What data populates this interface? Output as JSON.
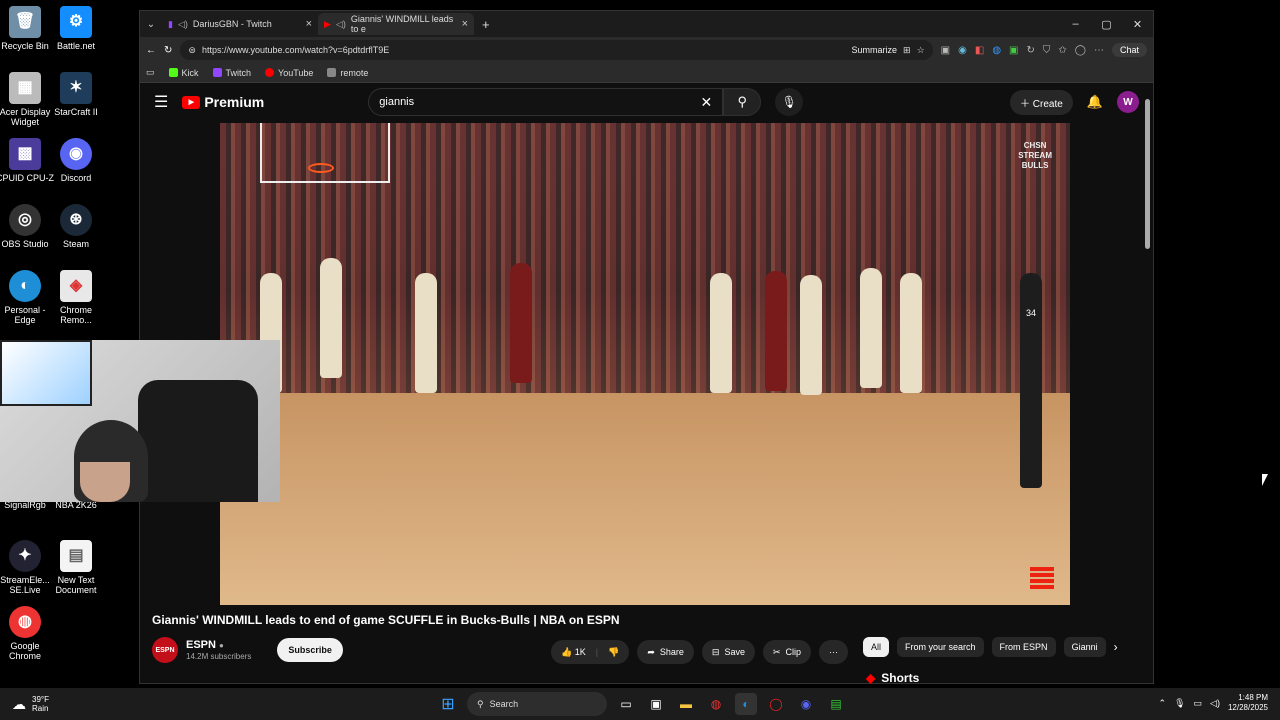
{
  "desktop": {
    "icons": [
      {
        "label": "Recycle Bin",
        "glyph": "🗑"
      },
      {
        "label": "Battle.net",
        "glyph": "⚙"
      },
      {
        "label": "Acer Display Widget",
        "glyph": "▦"
      },
      {
        "label": "StarCraft II",
        "glyph": "✶"
      },
      {
        "label": "CPUID CPU-Z",
        "glyph": "▩"
      },
      {
        "label": "Discord",
        "glyph": "◉"
      },
      {
        "label": "OBS Studio",
        "glyph": "◎"
      },
      {
        "label": "Steam",
        "glyph": "⊛"
      },
      {
        "label": "Personal - Edge",
        "glyph": "◐"
      },
      {
        "label": "Chrome Remo...",
        "glyph": "◈"
      },
      {
        "label": "SignalRgb",
        "glyph": "◆"
      },
      {
        "label": "NBA 2K26",
        "glyph": "▣"
      },
      {
        "label": "StreamEle... SE.Live",
        "glyph": "✦"
      },
      {
        "label": "New Text Document",
        "glyph": "▤"
      },
      {
        "label": "Google Chrome",
        "glyph": "◍"
      }
    ]
  },
  "browser": {
    "tabs": [
      {
        "label": "DariusGBN - Twitch",
        "active": false
      },
      {
        "label": "Giannis' WINDMILL leads to e",
        "active": true
      }
    ],
    "new_tab": "+",
    "url": "https://www.youtube.com/watch?v=6pdtdrflT9E",
    "summarize": "Summarize",
    "chat": "Chat",
    "bookmarks": [
      {
        "label": "Kick",
        "color": "#53fc18"
      },
      {
        "label": "Twitch",
        "color": "#9146ff"
      },
      {
        "label": "YouTube",
        "color": "#ff0000"
      },
      {
        "label": "remote",
        "color": "#888888"
      }
    ]
  },
  "youtube": {
    "logo": "Premium",
    "search_query": "giannis",
    "create": "Create",
    "avatar_letter": "W",
    "video": {
      "watermark": "CHSN\nSTREAM\nBULLS",
      "jersey": "34",
      "title": "Giannis' WINDMILL leads to end of game SCUFFLE in Bucks-Bulls | NBA on ESPN"
    },
    "channel": {
      "name": "ESPN",
      "subscribers": "14.2M subscribers",
      "logo_text": "ESPN"
    },
    "subscribe": "Subscribe",
    "actions": {
      "likes": "1K",
      "share": "Share",
      "save": "Save",
      "clip": "Clip",
      "more": "···"
    },
    "chips": [
      "All",
      "From your search",
      "From ESPN",
      "Gianni"
    ],
    "shorts": "Shorts"
  },
  "taskbar": {
    "weather_temp": "39°F",
    "weather_cond": "Rain",
    "search": "Search",
    "time": "1:48 PM",
    "date": "12/28/2025"
  }
}
